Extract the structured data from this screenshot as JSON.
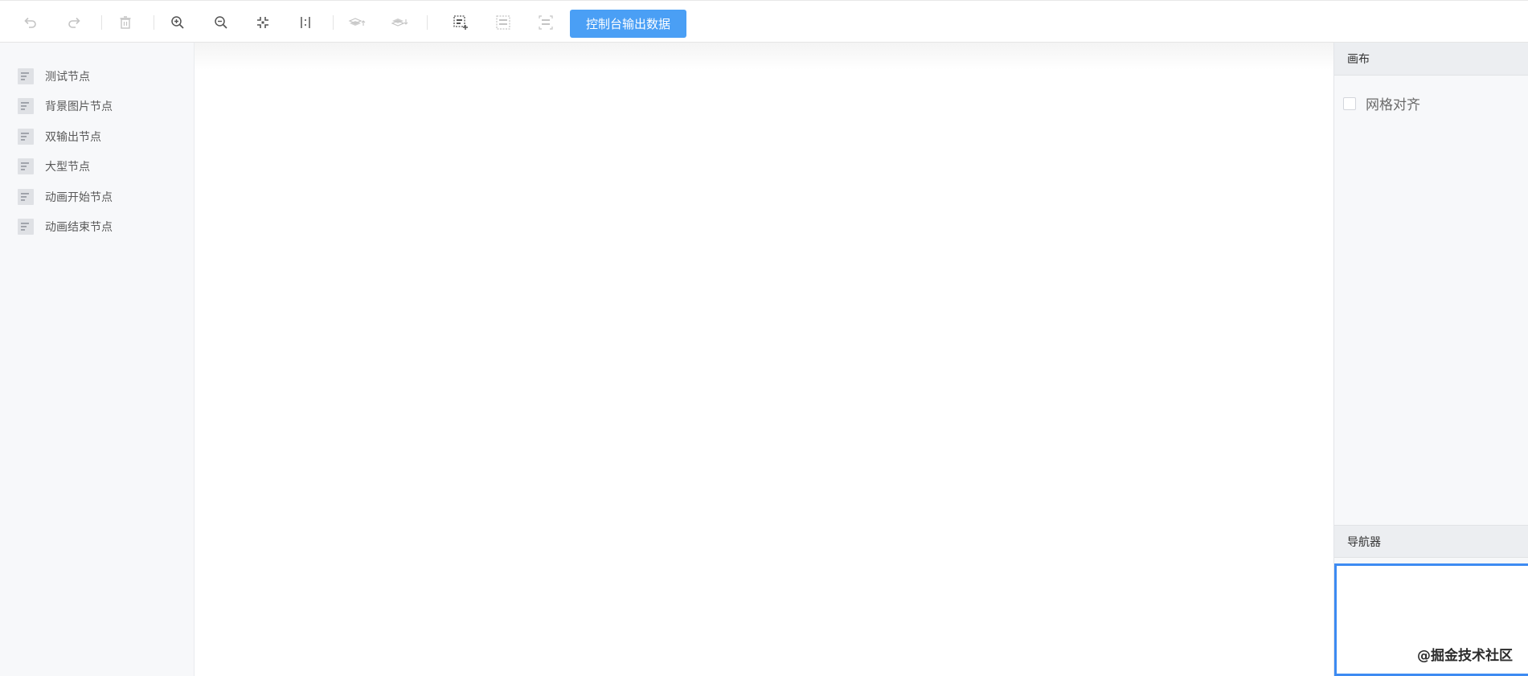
{
  "toolbar": {
    "icons": [
      "undo-icon",
      "redo-icon",
      "delete-icon",
      "zoom-in-icon",
      "zoom-out-icon",
      "fit-view-icon",
      "actual-size-icon",
      "bring-forward-icon",
      "send-backward-icon",
      "multi-select-icon",
      "group-icon",
      "ungroup-icon"
    ],
    "export_label": "控制台输出数据"
  },
  "sidebar": {
    "items": [
      {
        "label": "测试节点",
        "icon": "node-icon"
      },
      {
        "label": "背景图片节点",
        "icon": "node-icon"
      },
      {
        "label": "双输出节点",
        "icon": "node-icon"
      },
      {
        "label": "大型节点",
        "icon": "node-icon"
      },
      {
        "label": "动画开始节点",
        "icon": "node-icon"
      },
      {
        "label": "动画结束节点",
        "icon": "node-icon"
      }
    ]
  },
  "panel": {
    "canvas_title": "画布",
    "grid_align_label": "网格对齐",
    "grid_align_checked": false,
    "navigator_title": "导航器",
    "watermark": "@掘金技术社区"
  },
  "colors": {
    "accent": "#4a9ff5",
    "navigator_border": "#3d8bf2",
    "panel_bg": "#f7f8fa",
    "icon_dark": "#555555",
    "icon_light": "#c4c4c4"
  }
}
